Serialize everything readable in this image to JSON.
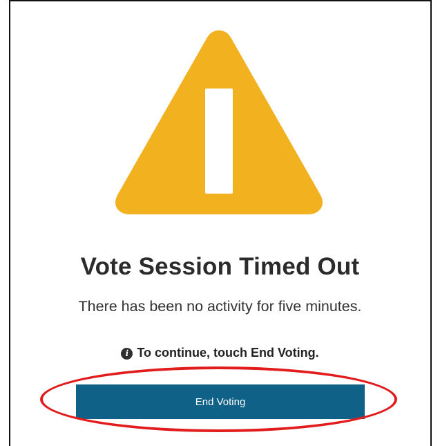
{
  "dialog": {
    "icon": "warning-triangle-icon",
    "title": "Vote Session Timed Out",
    "message": "There has been no activity for five minutes.",
    "instruction": {
      "icon": "info-icon",
      "icon_glyph": "i",
      "text": "To continue, touch End Voting."
    },
    "button_label": "End Voting"
  },
  "colors": {
    "warning": "#F2B11F",
    "button": "#0F6187",
    "highlight": "#E21C1C"
  }
}
